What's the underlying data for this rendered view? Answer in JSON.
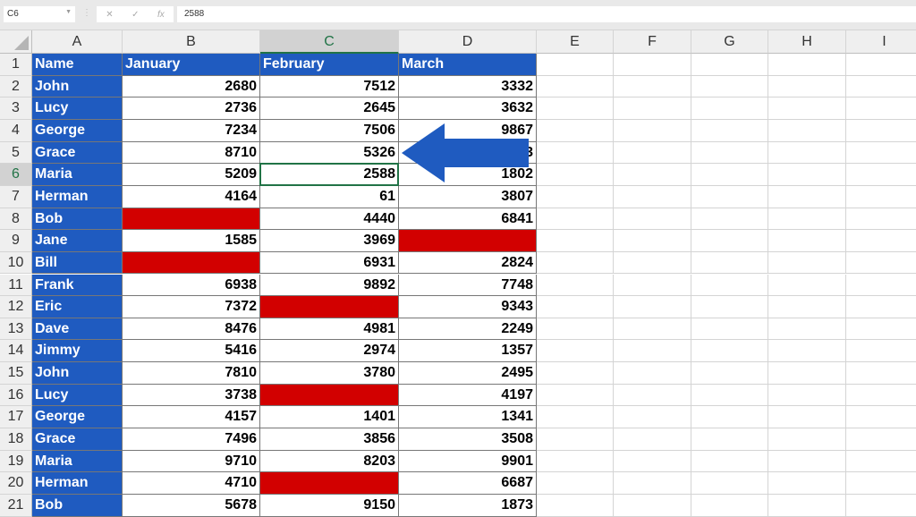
{
  "formula_bar": {
    "name_box": "C6",
    "cancel_icon": "✕",
    "enter_icon": "✓",
    "fx_label": "fx",
    "value": "2588"
  },
  "columns": [
    "A",
    "B",
    "C",
    "D",
    "E",
    "F",
    "G",
    "H",
    "I"
  ],
  "selected_cell": {
    "column": "C",
    "row": 6
  },
  "header_row": [
    "Name",
    "January",
    "February",
    "March"
  ],
  "rows": [
    [
      "John",
      "2680",
      "7512",
      "3332"
    ],
    [
      "Lucy",
      "2736",
      "2645",
      "3632"
    ],
    [
      "George",
      "7234",
      "7506",
      "9867"
    ],
    [
      "Grace",
      "8710",
      "5326",
      "3"
    ],
    [
      "Maria",
      "5209",
      "2588",
      "1802"
    ],
    [
      "Herman",
      "4164",
      "61",
      "3807"
    ],
    [
      "Bob",
      "",
      "4440",
      "6841"
    ],
    [
      "Jane",
      "1585",
      "3969",
      ""
    ],
    [
      "Bill",
      "",
      "6931",
      "2824"
    ],
    [
      "Frank",
      "6938",
      "9892",
      "7748"
    ],
    [
      "Eric",
      "7372",
      "",
      "9343"
    ],
    [
      "Dave",
      "8476",
      "4981",
      "2249"
    ],
    [
      "Jimmy",
      "5416",
      "2974",
      "1357"
    ],
    [
      "John",
      "7810",
      "3780",
      "2495"
    ],
    [
      "Lucy",
      "3738",
      "",
      "4197"
    ],
    [
      "George",
      "4157",
      "1401",
      "1341"
    ],
    [
      "Grace",
      "7496",
      "3856",
      "3508"
    ],
    [
      "Maria",
      "9710",
      "8203",
      "9901"
    ],
    [
      "Herman",
      "4710",
      "",
      "6687"
    ],
    [
      "Bob",
      "5678",
      "9150",
      "1873"
    ]
  ],
  "colors": {
    "name_fill": "#1f5bc0",
    "blank_fill": "#d20000",
    "arrow": "#1f5bc0",
    "selection": "#217346"
  },
  "annotation": {
    "icon": "arrow-left-icon"
  }
}
